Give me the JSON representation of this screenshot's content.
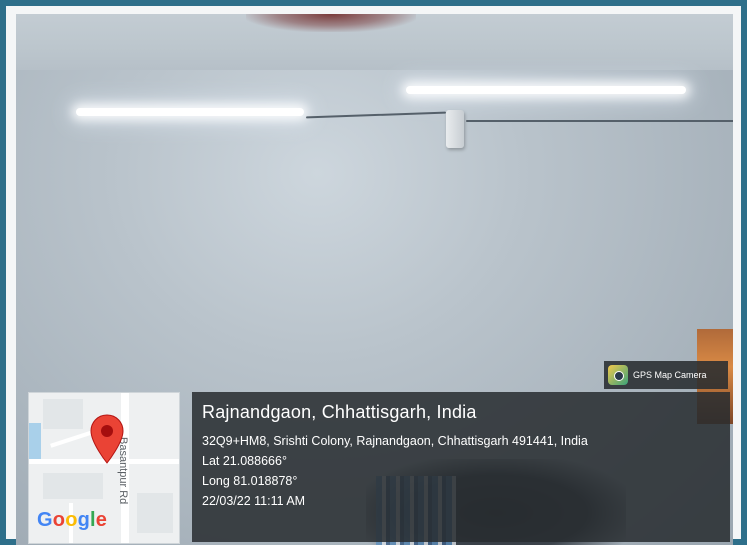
{
  "overlay": {
    "badge_label": "GPS Map Camera",
    "city": "Rajnandgaon, Chhattisgarh, India",
    "address": "32Q9+HM8, Srishti Colony, Rajnandgaon, Chhattisgarh 491441, India",
    "latitude": "Lat 21.088666°",
    "longitude": "Long 81.018878°",
    "timestamp": "22/03/22 11:11 AM"
  },
  "map": {
    "road_label": "Basantpur Rd",
    "logo_text": [
      "G",
      "o",
      "o",
      "g",
      "l",
      "e"
    ],
    "pin_icon": "map-pin-icon"
  },
  "colors": {
    "pin": "#EA4335",
    "panel": "#2c3034",
    "border": "#2e6f8a"
  }
}
